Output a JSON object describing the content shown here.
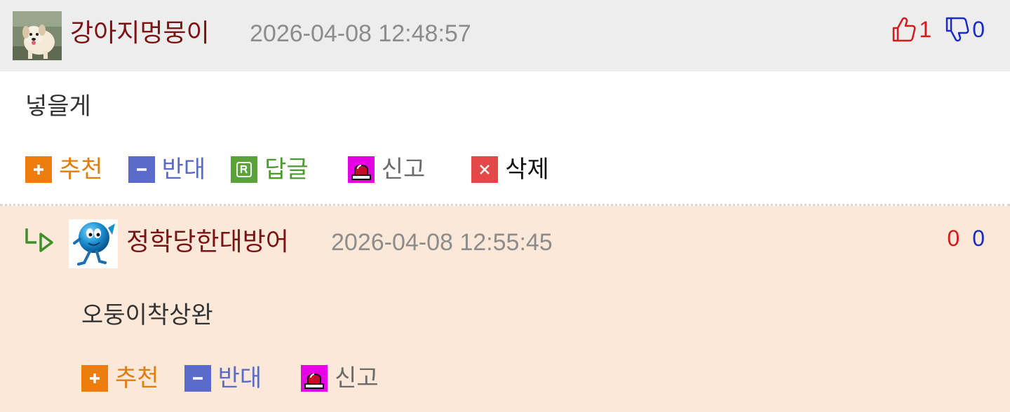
{
  "comment": {
    "author": "강아지멍뭉이",
    "timestamp": "2026-04-08 12:48:57",
    "up_votes": "1",
    "down_votes": "0",
    "text": "넣을게",
    "actions": {
      "recommend": "추천",
      "oppose": "반대",
      "reply": "답글",
      "report": "신고",
      "delete": "삭제"
    }
  },
  "reply": {
    "author": "정학당한대방어",
    "timestamp": "2026-04-08 12:55:45",
    "up_votes": "0",
    "down_votes": "0",
    "text": "오둥이착상완",
    "actions": {
      "recommend": "추천",
      "oppose": "반대",
      "report": "신고"
    }
  },
  "icons": {
    "recommend": "plus-icon",
    "oppose": "minus-icon",
    "reply": "r-badge-icon",
    "report": "siren-icon",
    "delete": "x-icon",
    "upvote": "thumbs-up-icon",
    "downvote": "thumbs-down-icon",
    "reply_marker": "reply-arrow-icon"
  },
  "colors": {
    "author": "#7a1414",
    "timestamp": "#8c8c8c",
    "up_count": "#d41a1a",
    "down_count": "#1a2bc9",
    "recommend": "#ee7d0f",
    "oppose": "#5a6bcc",
    "reply_action": "#5aa33a",
    "report_icon": "#e600e6",
    "delete_icon": "#e54848",
    "comment_header_bg": "#ededed",
    "reply_bg": "#fbe8d8"
  }
}
